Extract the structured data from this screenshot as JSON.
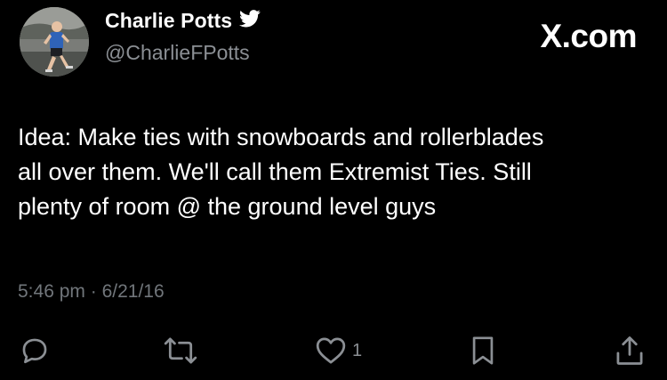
{
  "brand": "X.com",
  "author": {
    "display_name": "Charlie Potts",
    "handle": "@CharlieFPotts",
    "verified_icon": "twitter-bird-icon"
  },
  "tweet": {
    "text": "Idea: Make ties with snowboards and rollerblades\nall over them. We'll call them Extremist Ties. Still\nplenty of room @ the ground level guys",
    "time": "5:46 pm",
    "separator": "·",
    "date": "6/21/16"
  },
  "actions": {
    "reply_icon": "reply-icon",
    "retweet_icon": "retweet-icon",
    "like_icon": "heart-icon",
    "like_count": "1",
    "bookmark_icon": "bookmark-icon",
    "share_icon": "share-icon"
  },
  "colors": {
    "background": "#000000",
    "primary_text": "#ffffff",
    "secondary_text": "#71767b"
  }
}
